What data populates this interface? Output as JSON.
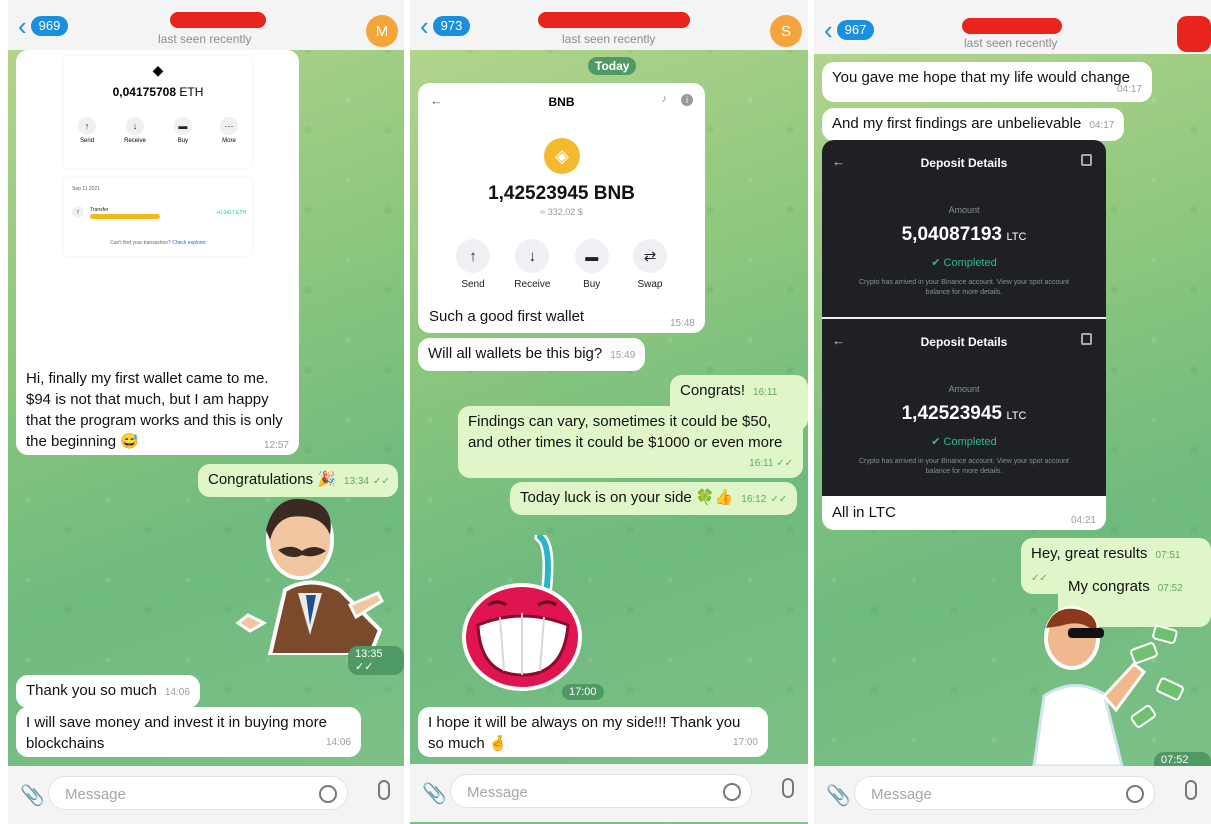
{
  "panels": [
    {
      "header": {
        "back_count": "969",
        "status": "last seen recently",
        "avatar_letter": "M",
        "avatar_color": "#f4a43a"
      },
      "wallet": {
        "amount": "0,04175708",
        "unit": "ETH",
        "actions": [
          "Send",
          "Receive",
          "Buy",
          "More"
        ],
        "tx_label": "Transfer",
        "tx_value": "+0,0417 ETH",
        "tx_date": "Sep 11 2021",
        "explorer_text": "Can't find your transaction?",
        "explorer_link": "Check explorer"
      },
      "messages": {
        "m1_text": "Hi, finally my first wallet came to me. $94 is not that much, but I am happy that the program works and this is only the beginning 😅",
        "m1_time": "12:57",
        "m2_text": "Congratulations 🎉",
        "m2_time": "13:34",
        "sticker_time": "13:35",
        "m3_text": "Thank you so much",
        "m3_time": "14:06",
        "m4_text": "I will save money and invest it in buying more blockchains",
        "m4_time": "14:06"
      },
      "input_placeholder": "Message"
    },
    {
      "header": {
        "back_count": "973",
        "status": "last seen recently",
        "avatar_letter": "S",
        "avatar_color": "#f4a43a"
      },
      "today_label": "Today",
      "wallet": {
        "title": "BNB",
        "amount": "1,42523945 BNB",
        "fiat": "≈ 332,02 $",
        "actions": [
          "Send",
          "Receive",
          "Buy",
          "Swap"
        ],
        "caption": "Such a good first wallet",
        "caption_time": "15:48"
      },
      "messages": {
        "m1_text": "Will all wallets be this big?",
        "m1_time": "15:49",
        "m2_text": "Congrats!",
        "m2_time": "16:11",
        "m3_text": "Findings can vary, sometimes it could be $50, and other times it could be $1000 or even more",
        "m3_time": "16:11",
        "m4_text": "Today luck is on your side 🍀👍",
        "m4_time": "16:12",
        "sticker_time": "17:00",
        "m5_text": "I hope it will be always on my side!!! Thank you so much 🤞",
        "m5_time": "17:00"
      },
      "input_placeholder": "Message"
    },
    {
      "header": {
        "back_count": "967",
        "status": "last seen recently"
      },
      "messages": {
        "m1_text": "You gave me hope that my life would change",
        "m1_time": "04:17",
        "m2_text": "And my first findings are unbelievable",
        "m2_time": "04:17",
        "caption": "All in LTC",
        "caption_time": "04:21",
        "m3_text": "Hey, great results",
        "m3_time": "07:51",
        "m4_text": "My congrats",
        "m4_time": "07:52",
        "sticker_time": "07:52"
      },
      "deposits": [
        {
          "title": "Deposit Details",
          "amount_label": "Amount",
          "amount": "5,04087193",
          "unit": "LTC",
          "status": "Completed",
          "note": "Crypto has arrived in your Binance account. View your spot account balance for more details."
        },
        {
          "title": "Deposit Details",
          "amount_label": "Amount",
          "amount": "1,42523945",
          "unit": "LTC",
          "status": "Completed",
          "note": "Crypto has arrived in your Binance account. View your spot account balance for more details."
        }
      ],
      "input_placeholder": "Message"
    }
  ],
  "colors": {
    "accent": "#1a8fe0",
    "outgoing_bubble": "#e1f6c8",
    "binance_yellow": "#f3ba2f",
    "completed_green": "#2ebd85",
    "redaction": "#e8241c"
  }
}
